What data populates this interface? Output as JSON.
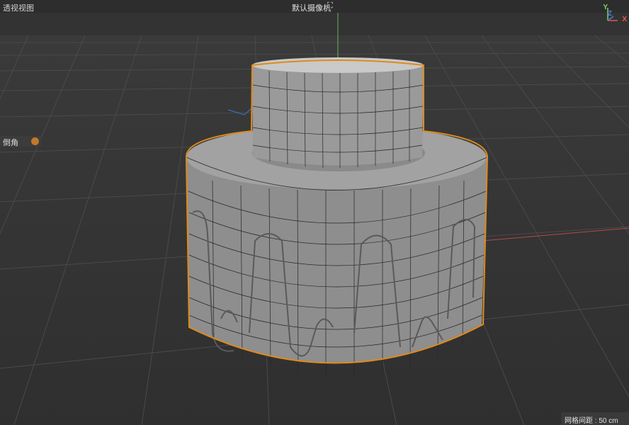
{
  "viewport": {
    "title": "透视视图",
    "camera_label": "默认摄像机",
    "camera_icon": "camera-link-icon"
  },
  "tool_panel": {
    "label": "倒角",
    "icon": "bevel-tool-icon"
  },
  "status": {
    "grid_spacing": "网格间距 : 50 cm"
  },
  "axis_gizmo": {
    "y_label": "Y",
    "z_label": "Z",
    "x_label": "X"
  },
  "colors": {
    "x_axis": "#e05a50",
    "y_axis": "#7ed36a",
    "z_axis": "#4a7fd8",
    "selection_outline": "#e08a1c"
  }
}
